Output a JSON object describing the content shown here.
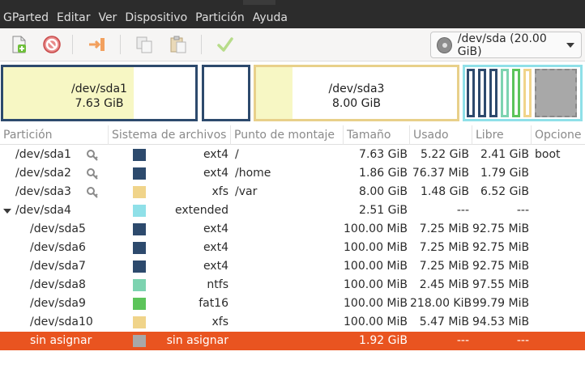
{
  "menubar": [
    "GParted",
    "Editar",
    "Ver",
    "Dispositivo",
    "Partición",
    "Ayuda"
  ],
  "toolbar": {
    "icons": [
      "new-partition-icon",
      "delete-icon",
      "resize-move-icon",
      "copy-icon",
      "paste-icon",
      "apply-icon"
    ],
    "device_label": "/dev/sda (20.00 GiB)"
  },
  "diskmap": {
    "sda1": {
      "name": "/dev/sda1",
      "size": "7.63 GiB",
      "used_fraction": 0.68
    },
    "sda3": {
      "name": "/dev/sda3",
      "size": "8.00 GiB",
      "used_fraction": 0.18
    }
  },
  "table": {
    "headers": [
      "Partición",
      "Sistema de archivos",
      "Punto de montaje",
      "Tamaño",
      "Usado",
      "Libre",
      "Opcione"
    ],
    "rows": [
      {
        "partition": "/dev/sda1",
        "key": true,
        "fs_color": "#2d4a6d",
        "fs": "ext4",
        "mount": "/",
        "size": "7.63 GiB",
        "used": "5.22 GiB",
        "free": "2.41 GiB",
        "flags": "boot"
      },
      {
        "partition": "/dev/sda2",
        "key": true,
        "fs_color": "#2d4a6d",
        "fs": "ext4",
        "mount": "/home",
        "size": "1.86 GiB",
        "used": "76.37 MiB",
        "free": "1.79 GiB",
        "flags": ""
      },
      {
        "partition": "/dev/sda3",
        "key": true,
        "fs_color": "#f0d48a",
        "fs": "xfs",
        "mount": "/var",
        "size": "8.00 GiB",
        "used": "1.48 GiB",
        "free": "6.52 GiB",
        "flags": ""
      },
      {
        "partition": "/dev/sda4",
        "key": false,
        "expander": true,
        "fs_color": "#8fe0e8",
        "fs": "extended",
        "mount": "",
        "size": "2.51 GiB",
        "used": "---",
        "free": "---",
        "flags": ""
      },
      {
        "partition": "/dev/sda5",
        "key": false,
        "child": true,
        "fs_color": "#2d4a6d",
        "fs": "ext4",
        "mount": "",
        "size": "100.00 MiB",
        "used": "7.25 MiB",
        "free": "92.75 MiB",
        "flags": ""
      },
      {
        "partition": "/dev/sda6",
        "key": false,
        "child": true,
        "fs_color": "#2d4a6d",
        "fs": "ext4",
        "mount": "",
        "size": "100.00 MiB",
        "used": "7.25 MiB",
        "free": "92.75 MiB",
        "flags": ""
      },
      {
        "partition": "/dev/sda7",
        "key": false,
        "child": true,
        "fs_color": "#2d4a6d",
        "fs": "ext4",
        "mount": "",
        "size": "100.00 MiB",
        "used": "7.25 MiB",
        "free": "92.75 MiB",
        "flags": ""
      },
      {
        "partition": "/dev/sda8",
        "key": false,
        "child": true,
        "fs_color": "#7dd3b0",
        "fs": "ntfs",
        "mount": "",
        "size": "100.00 MiB",
        "used": "2.45 MiB",
        "free": "97.55 MiB",
        "flags": ""
      },
      {
        "partition": "/dev/sda9",
        "key": false,
        "child": true,
        "fs_color": "#5cc45a",
        "fs": "fat16",
        "mount": "",
        "size": "100.00 MiB",
        "used": "218.00 KiB",
        "free": "99.79 MiB",
        "flags": ""
      },
      {
        "partition": "/dev/sda10",
        "key": false,
        "child": true,
        "fs_color": "#f0d48a",
        "fs": "xfs",
        "mount": "",
        "size": "100.00 MiB",
        "used": "5.47 MiB",
        "free": "94.53 MiB",
        "flags": ""
      },
      {
        "partition": "sin asignar",
        "key": false,
        "child": true,
        "selected": true,
        "fs_color": "#a8a8a8",
        "fs": "sin asignar",
        "mount": "",
        "size": "1.92 GiB",
        "used": "---",
        "free": "---",
        "flags": ""
      }
    ]
  }
}
